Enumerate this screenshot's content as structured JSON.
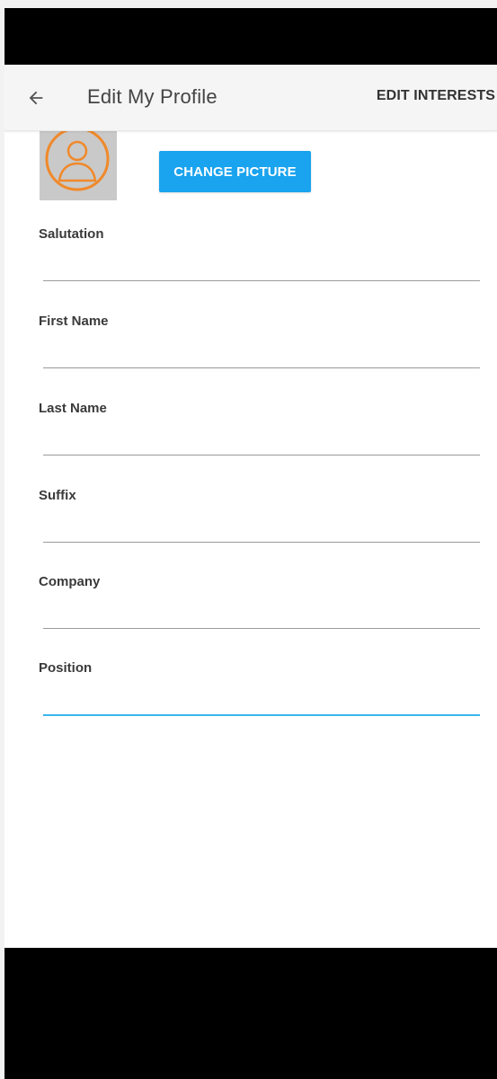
{
  "app_bar": {
    "title": "Edit My Profile",
    "back_icon": "arrow-left-icon",
    "action_label": "EDIT INTERESTS"
  },
  "profile": {
    "avatar_icon": "user-avatar-icon",
    "avatar_ring_color": "#f0892a",
    "change_picture_label": "CHANGE PICTURE"
  },
  "form": {
    "fields": [
      {
        "label": "Salutation",
        "value": ""
      },
      {
        "label": "First Name",
        "value": ""
      },
      {
        "label": "Last Name",
        "value": ""
      },
      {
        "label": "Suffix",
        "value": ""
      },
      {
        "label": "Company",
        "value": ""
      },
      {
        "label": "Position",
        "value": ""
      }
    ]
  },
  "colors": {
    "accent": "#1aa3ee",
    "focus_underline": "#38b6ee"
  }
}
